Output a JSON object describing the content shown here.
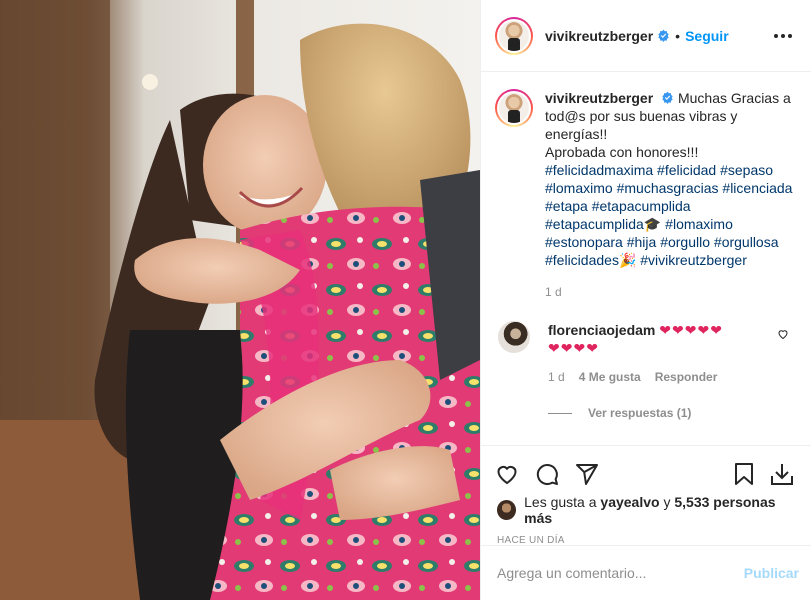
{
  "post": {
    "username": "vivikreutzberger",
    "follow_label": "Seguir",
    "dot": "•"
  },
  "caption": {
    "username": "vivikreutzberger",
    "lines": [
      "Muchas Gracias a",
      "tod@s por sus buenas vibras y",
      "energías!!",
      "Aprobada con honores!!!"
    ],
    "hashtag_lines": [
      "#felicidadmaxima #felicidad #sepaso",
      "#lomaximo #muchasgracias #licenciada",
      "#etapa #etapacumplida",
      "#etapacumplida🎓 #lomaximo",
      "#estonopara #hija #orgullo #orgullosa",
      "#felicidades🎉 #vivikreutzberger"
    ],
    "age": "1 d"
  },
  "comment": {
    "username": "florenciaojedam",
    "hearts_line1": "❤❤❤❤❤",
    "hearts_line2": "❤❤❤❤",
    "age": "1 d",
    "likes": "4 Me gusta",
    "reply": "Responder",
    "view_replies": "Ver respuestas (1)"
  },
  "likes": {
    "prefix": "Les gusta a",
    "user": "yayealvo",
    "joiner": "y",
    "others": "5,533 personas más"
  },
  "timestamp": "HACE UN DÍA",
  "composer": {
    "placeholder": "Agrega un comentario...",
    "publish": "Publicar"
  },
  "colors": {
    "accent": "#0095f6",
    "hashtag": "#00376b",
    "muted": "#8e8e8e",
    "heart": "#e0245e"
  },
  "icons": [
    "verified-badge-icon",
    "more-options-icon",
    "heart-icon",
    "comment-icon",
    "share-icon",
    "bookmark-icon",
    "download-icon"
  ]
}
